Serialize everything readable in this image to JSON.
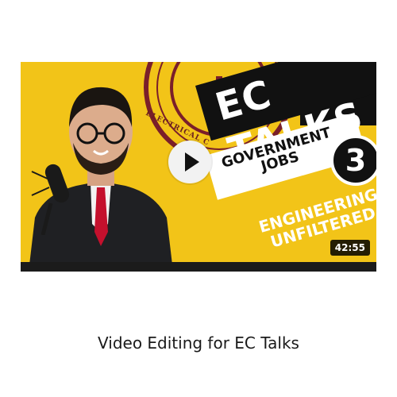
{
  "video": {
    "title_main": "EC TALKS",
    "episode_number": "3",
    "subtitle": "GOVERNMENT JOBS",
    "tagline_line1": "ENGINEERING",
    "tagline_line2": "UNFILTERED",
    "seal_text": "ELECTRICAL C",
    "duration": "42:55",
    "play_icon": "play-icon"
  },
  "caption": "Video Editing for EC Talks",
  "colors": {
    "accent_yellow": "#f2c418",
    "banner_black": "#111111",
    "background": "#ffffff"
  }
}
